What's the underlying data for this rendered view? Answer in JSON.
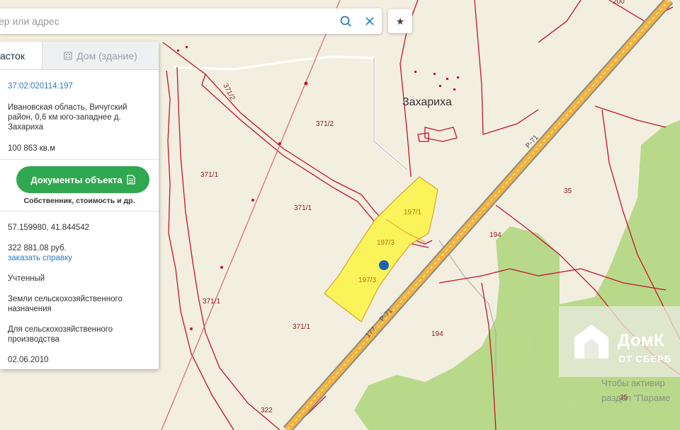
{
  "search": {
    "placeholder": "ер или адрес"
  },
  "tabs": [
    {
      "label": "асток",
      "active": true
    },
    {
      "label": "Дом (здание)",
      "active": false,
      "icon": "building-icon"
    }
  ],
  "parcel": {
    "cadastral_number": "37:02:020114:197",
    "address": "Ивановская область, Вичугский район, 0,6 км юго-западнее д. Захариха",
    "area": "100 863 кв.м",
    "documents_button": "Документы объекта",
    "documents_hint": "Собственник, стоимость и др.",
    "coordinates": "57.159980, 41.844542",
    "cadastral_value": "322 881.08 руб.",
    "order_certificate": "заказать справку",
    "status": "Учтенный",
    "category": "Земли сельскохозяйственного назначения",
    "permitted_use": "Для сельскохозяйственного производства",
    "registration_date": "02.06.2010"
  },
  "map": {
    "village_label": "Захариха",
    "road_labels": [
      "Р-71",
      "Р-71",
      "177"
    ],
    "parcel_labels": [
      "371/2",
      "371/2",
      "371/1",
      "371/1",
      "371/1",
      "371/1",
      "197/1",
      "197/3",
      "197/3",
      "194",
      "194",
      "35",
      "35",
      "322",
      "200"
    ],
    "colors": {
      "highlight": "#fbf35a",
      "boundary": "#c8102e",
      "road": "#f2b33d",
      "forest": "#b8d98a",
      "background": "#f3efe0"
    }
  },
  "watermark": {
    "brand": "ДомК",
    "brand_sub": "ОТ СБЕРБ"
  },
  "activation": {
    "line1": "Чтобы активир",
    "line2": "раздел \"Параме"
  }
}
